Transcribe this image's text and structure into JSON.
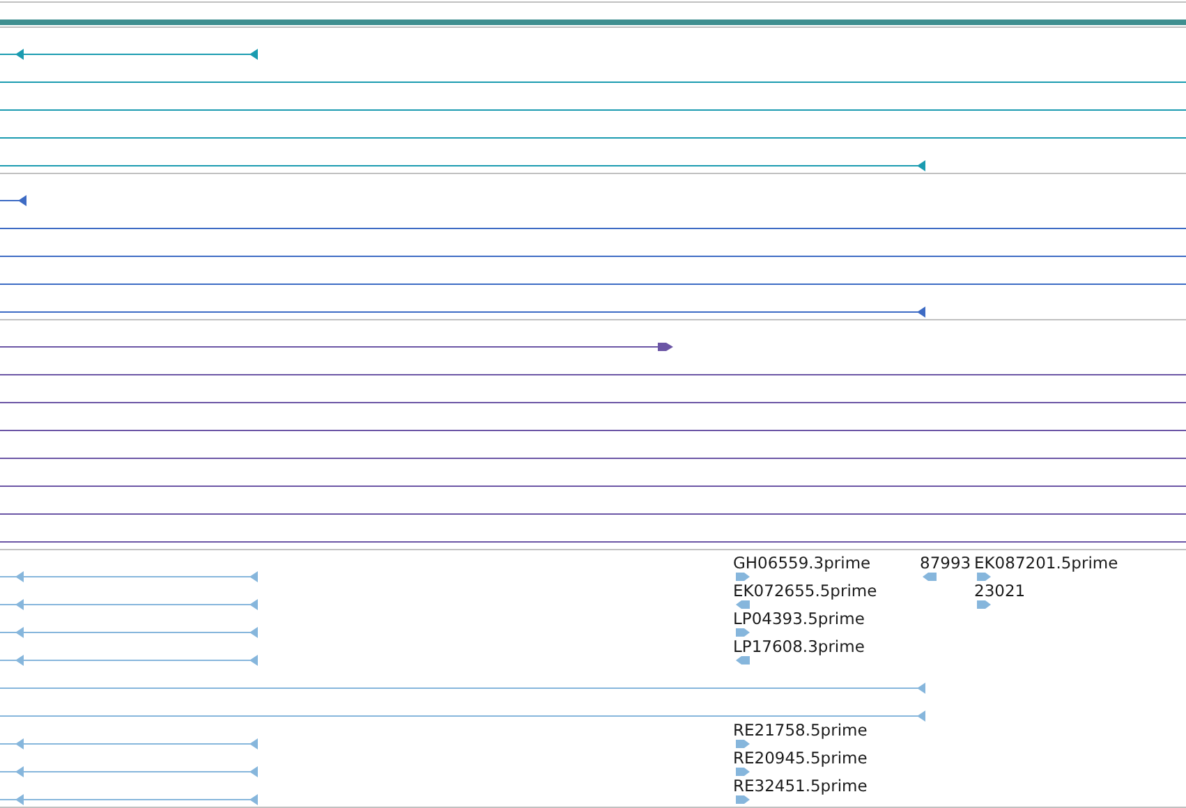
{
  "header_bar": {
    "color": "#3f8f90"
  },
  "tracks": [
    {
      "color": "#1a9bb0",
      "rows": [
        {
          "kind": "short"
        },
        {
          "kind": "full"
        },
        {
          "kind": "full"
        },
        {
          "kind": "full"
        },
        {
          "kind": "long"
        }
      ]
    },
    {
      "color": "#3d6bc4",
      "rows": [
        {
          "kind": "stub"
        },
        {
          "kind": "full"
        },
        {
          "kind": "full"
        },
        {
          "kind": "full"
        },
        {
          "kind": "long"
        }
      ]
    },
    {
      "color": "#6b55a5",
      "rows": [
        {
          "kind": "plus"
        },
        {
          "kind": "full"
        },
        {
          "kind": "full"
        },
        {
          "kind": "full"
        },
        {
          "kind": "full"
        },
        {
          "kind": "full"
        },
        {
          "kind": "full"
        },
        {
          "kind": "full"
        }
      ]
    },
    {
      "color": "#86b6dc",
      "rows": [
        {
          "kind": "short",
          "labels": [
            {
              "text": "GH06559.3prime",
              "kind": "main",
              "reverse": false
            },
            {
              "text": "87993",
              "kind": "mid",
              "reverse": true
            },
            {
              "text": "EK087201.5prime",
              "kind": "far",
              "reverse": false
            }
          ]
        },
        {
          "kind": "short",
          "labels": [
            {
              "text": "EK072655.5prime",
              "kind": "main",
              "reverse": true
            },
            {
              "text": "23021",
              "kind": "far",
              "reverse": false
            }
          ]
        },
        {
          "kind": "short",
          "labels": [
            {
              "text": "LP04393.5prime",
              "kind": "main",
              "reverse": false
            }
          ]
        },
        {
          "kind": "short",
          "labels": [
            {
              "text": "LP17608.3prime",
              "kind": "main",
              "reverse": true
            }
          ]
        },
        {
          "kind": "long"
        },
        {
          "kind": "long"
        },
        {
          "kind": "short",
          "labels": [
            {
              "text": "RE21758.5prime",
              "kind": "main",
              "reverse": false
            }
          ]
        },
        {
          "kind": "short",
          "labels": [
            {
              "text": "RE20945.5prime",
              "kind": "main",
              "reverse": false
            }
          ]
        },
        {
          "kind": "short",
          "labels": [
            {
              "text": "RE32451.5prime",
              "kind": "main",
              "reverse": false
            }
          ]
        }
      ]
    }
  ]
}
